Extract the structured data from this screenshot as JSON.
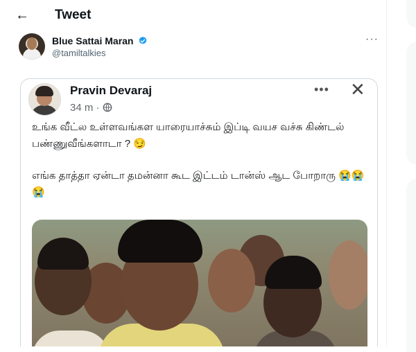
{
  "header": {
    "back_icon": "arrow-left-icon",
    "title": "Tweet"
  },
  "author": {
    "name": "Blue Sattai Maran",
    "handle": "@tamiltalkies",
    "verified_icon": "verified-badge-icon",
    "more_icon": "more-horizontal-icon",
    "more_glyph": "···"
  },
  "embedded_post": {
    "name": "Pravin Devaraj",
    "time": "34 m · ",
    "privacy_icon": "globe-icon",
    "options_glyph": "•••",
    "close_glyph": "✕",
    "line1": "உங்க வீட்ல உள்ளவங்கள யாரையாச்சும் இப்டி வயச வச்சு கிண்டல் பண்ணுவீங்களாடா ? 😏",
    "line2": "எங்க தாத்தா ஏன்டா தமன்னா கூட இட்டம் டான்ஸ் ஆட போறாரு 😭😭😭"
  },
  "colors": {
    "verified": "#1d9bf0",
    "text": "#0f1419",
    "muted": "#536471",
    "border": "#cfd9de"
  }
}
